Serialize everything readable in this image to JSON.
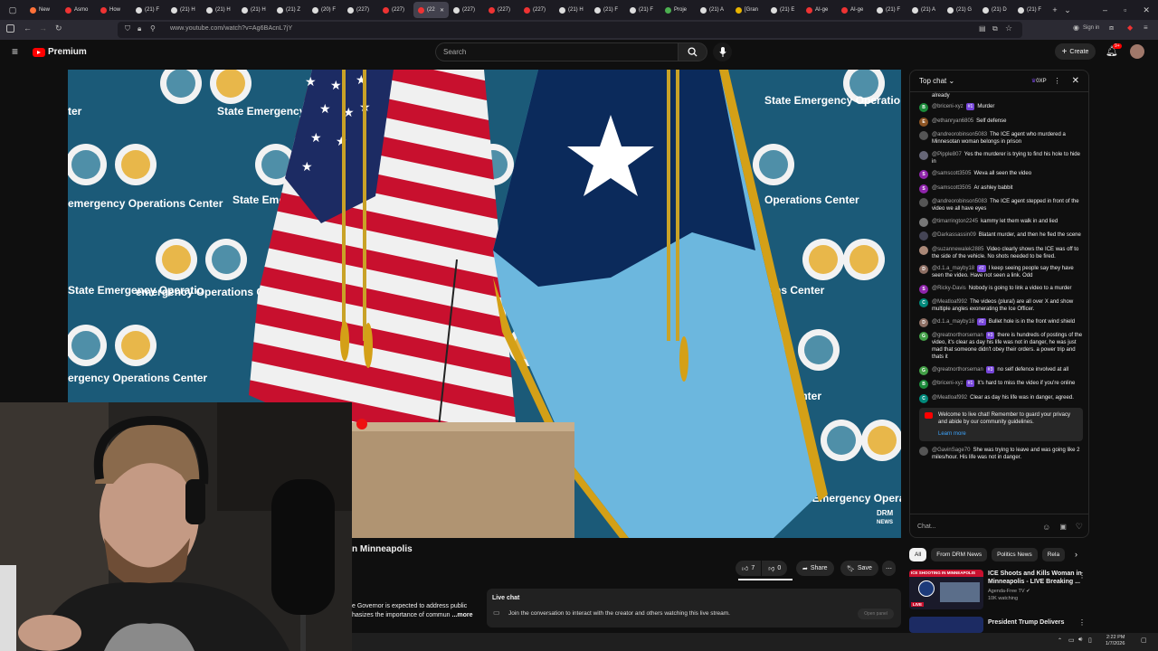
{
  "browser": {
    "tabs": [
      {
        "label": "New",
        "color": "#ff7139"
      },
      {
        "label": "Asmo",
        "color": "#e33"
      },
      {
        "label": "How",
        "color": "#e33"
      },
      {
        "label": "(21) F",
        "color": "#ddd"
      },
      {
        "label": "(21) H",
        "color": "#ddd"
      },
      {
        "label": "(21) H",
        "color": "#ddd"
      },
      {
        "label": "(21) H",
        "color": "#ddd"
      },
      {
        "label": "(21) Z",
        "color": "#ddd"
      },
      {
        "label": "(20) F",
        "color": "#ddd"
      },
      {
        "label": "(227)",
        "color": "#ddd"
      },
      {
        "label": "(227)",
        "color": "#e33"
      },
      {
        "label": "(22",
        "color": "#e33",
        "active": true
      },
      {
        "label": "(227)",
        "color": "#ddd"
      },
      {
        "label": "(227)",
        "color": "#e33"
      },
      {
        "label": "(227)",
        "color": "#e33"
      },
      {
        "label": "(21) H",
        "color": "#ddd"
      },
      {
        "label": "(21) F",
        "color": "#ddd"
      },
      {
        "label": "(21) F",
        "color": "#ddd"
      },
      {
        "label": "Proje",
        "color": "#4caf50"
      },
      {
        "label": "(21) A",
        "color": "#ddd"
      },
      {
        "label": "[Gran",
        "color": "#e8b400"
      },
      {
        "label": "(21) E",
        "color": "#ddd"
      },
      {
        "label": "AI-ge",
        "color": "#e33"
      },
      {
        "label": "AI-ge",
        "color": "#e33"
      },
      {
        "label": "(21) F",
        "color": "#ddd"
      },
      {
        "label": "(21) A",
        "color": "#ddd"
      },
      {
        "label": "(21) G",
        "color": "#ddd"
      },
      {
        "label": "(21) D",
        "color": "#ddd"
      },
      {
        "label": "(21) F",
        "color": "#ddd"
      }
    ],
    "url": "www.youtube.com/watch?v=Ag6BAcnL7jY",
    "signin": "Sign in"
  },
  "youtube": {
    "logo": "Premium",
    "search_placeholder": "Search",
    "create_label": "Create",
    "notif_count": "9+"
  },
  "video": {
    "backdrop_text": "State Emergency Operations Center",
    "backdrop_fragments": [
      "ter",
      "emergency Operations Center",
      "State Emergency Operations Center",
      "State Emergency Operatio",
      "nter",
      "emergency Operations Center",
      "State Emer",
      "ergency Operations Center",
      "State Emergency Operatio",
      "rations Center",
      "Operations Center",
      "Center",
      "State Emergency Operatio"
    ],
    "watermark_top": "DRM",
    "watermark_bottom": "NEWS",
    "title": "n Minneapolis",
    "description": "e Governor is expected to address public\nhasizes the importance of commun",
    "more": "...more",
    "likes": "7",
    "dislikes": "0",
    "share": "Share",
    "save": "Save"
  },
  "live_chat_box": {
    "title": "Live chat",
    "text": "Join the conversation to interact with the creator and others watching this live stream.",
    "button": "Open panel"
  },
  "chat": {
    "header": "Top chat",
    "points": "0XP",
    "first_line": "already",
    "messages": [
      {
        "author": "@briceni-xyz",
        "badge": "#1",
        "text": "Murder",
        "avatar": "B",
        "color": "#1b8a3a"
      },
      {
        "author": "@ethanryan6805",
        "badge": "",
        "text": "Self defense",
        "avatar": "E",
        "color": "#8d5524"
      },
      {
        "author": "@andreorobinson5083",
        "badge": "",
        "text": "The ICE agent who murdered a Minnesotan woman belongs in prison",
        "avatar": "",
        "color": "#555"
      },
      {
        "author": "@Pipple807",
        "badge": "",
        "text": "Yes the murderer is trying to find his hole to hide in",
        "avatar": "",
        "color": "#667"
      },
      {
        "author": "@samscott3505",
        "badge": "",
        "text": "Weva all seen the video",
        "avatar": "S",
        "color": "#8e24aa"
      },
      {
        "author": "@samscott3505",
        "badge": "",
        "text": "Ar ashley babbit",
        "avatar": "S",
        "color": "#8e24aa"
      },
      {
        "author": "@andreorobinson5083",
        "badge": "",
        "text": "The ICE agent stepped in front of the video we all have eyes",
        "avatar": "",
        "color": "#555"
      },
      {
        "author": "@timarrington2245",
        "badge": "",
        "text": "kammy let them walk in and lied",
        "avatar": "",
        "color": "#777"
      },
      {
        "author": "@Darkassassin09",
        "badge": "",
        "text": "Blatant murder, and then he fled the scene",
        "avatar": "",
        "color": "#445"
      },
      {
        "author": "@suzannewalek2885",
        "badge": "",
        "text": "Video clearly shows the ICE was off to the side of the vehicle. No shots needed to be fired.",
        "avatar": "",
        "color": "#a87"
      },
      {
        "author": "@d.1.a_mayby18",
        "badge": "#2",
        "text": "I keep seeing people say they have seen the video. Have not seen a link. Odd",
        "avatar": "D",
        "color": "#8d6e63"
      },
      {
        "author": "@Ricky-Davis",
        "badge": "",
        "text": "Nobody is going to link a video to a murder",
        "avatar": "S",
        "color": "#8e24aa"
      },
      {
        "author": "@Meatloaf992",
        "badge": "",
        "text": "The videos (plural) are all over X and show multiple angles exonerating the Ice Officer.",
        "avatar": "C",
        "color": "#00897b"
      },
      {
        "author": "@d.1.a_mayby18",
        "badge": "#2",
        "text": "Bullet hole is in the front wind shield",
        "avatar": "D",
        "color": "#8d6e63"
      },
      {
        "author": "@greatnorthorseman",
        "badge": "#3",
        "text": "there is hundreds of postings of the video, it's clear as day his life was not in danger, he was just mad that someone didn't obey their orders. a power trip and thats it",
        "avatar": "G",
        "color": "#43a047"
      },
      {
        "author": "@greatnorthorseman",
        "badge": "#3",
        "text": "no self defence involved at all",
        "avatar": "G",
        "color": "#43a047"
      },
      {
        "author": "@briceni-xyz",
        "badge": "#1",
        "text": "It's hard to miss the video if you're online",
        "avatar": "B",
        "color": "#1b8a3a"
      },
      {
        "author": "@Meatloaf992",
        "badge": "",
        "text": "Clear as day his life was in danger, agreed.",
        "avatar": "C",
        "color": "#00897b"
      }
    ],
    "welcome": "Welcome to live chat! Remember to guard your privacy and abide by our community guidelines.",
    "learn_more": "Learn more",
    "last": {
      "author": "@GavinSage70",
      "text": "She was trying to leave and was going like 2 miles/hour. His life was not in danger.",
      "color": "#555"
    },
    "input_placeholder": "Chat..."
  },
  "filters": [
    "All",
    "From DRM News",
    "Politics News",
    "Rela"
  ],
  "recommendations": [
    {
      "title": "ICE Shoots and Kills Woman in Minneapolis - LIVE Breaking ...",
      "channel": "Agenda-Free TV",
      "meta": "10K watching",
      "thumb_text": "ICE SHOOTING IN MINNEAPOLIS",
      "live": "LIVE"
    },
    {
      "title": "President Trump Delivers",
      "channel": "",
      "meta": "",
      "thumb_text": "",
      "live": ""
    }
  ],
  "taskbar": {
    "time": "2:22 PM",
    "date": "1/7/2026"
  },
  "colors": {
    "accent": "#ff0000",
    "badge": "#7645d9",
    "backdrop": "#1b5a78"
  }
}
